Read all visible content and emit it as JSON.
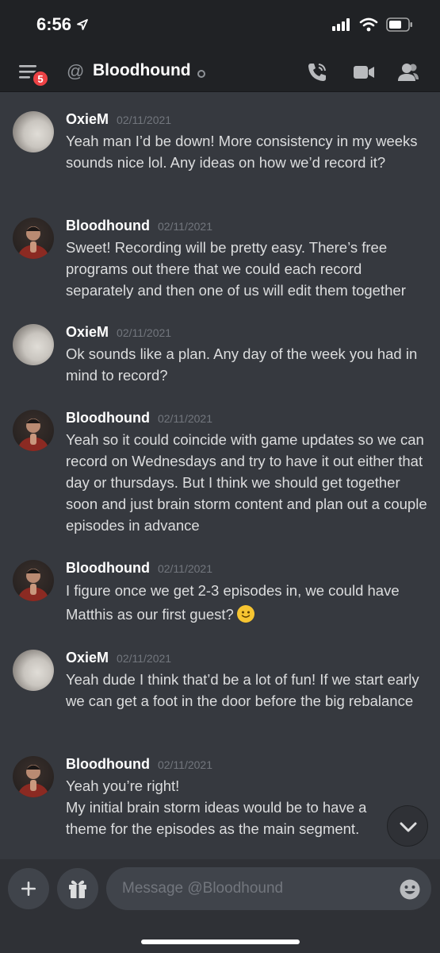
{
  "status_bar": {
    "time": "6:56"
  },
  "header": {
    "title": "Bloodhound",
    "badge": "5"
  },
  "messages": [
    {
      "author": "OxieM",
      "timestamp": "02/11/2021",
      "text": "Yeah man I’d be down! More consistency in my weeks sounds nice lol. Any ideas on how we’d record it?"
    },
    {
      "author": "Bloodhound",
      "timestamp": "02/11/2021",
      "text": "Sweet! Recording will be pretty easy. There’s free programs out there that we could each record separately and then one of us will edit them together"
    },
    {
      "author": "OxieM",
      "timestamp": "02/11/2021",
      "text": "Ok sounds like a plan. Any day of the week you had in mind to record?"
    },
    {
      "author": "Bloodhound",
      "timestamp": "02/11/2021",
      "text": "Yeah so it could coincide with game updates so we can record on Wednesdays and try to have it out either that day or thursdays. But I think we should get together soon and just brain storm content and plan out a couple episodes in advance"
    },
    {
      "author": "Bloodhound",
      "timestamp": "02/11/2021",
      "text": "I figure once we get 2-3 episodes in, we could have Matthis as our first guest?"
    },
    {
      "author": "OxieM",
      "timestamp": "02/11/2021",
      "text": "Yeah dude I think that’d be a lot of fun! If we start early we can get a foot in the door before the big rebalance"
    },
    {
      "author": "Bloodhound",
      "timestamp": "02/11/2021",
      "text_line1": "Yeah you’re right!",
      "text_line2": "My initial brain storm ideas would be to have a theme for the episodes as the main segment."
    }
  ],
  "composer": {
    "placeholder": "Message @Bloodhound"
  },
  "icons": {
    "menu": "hamburger-icon",
    "location": "location-arrow-icon",
    "call": "phone-icon",
    "video": "video-camera-icon",
    "members": "members-icon",
    "add": "plus-icon",
    "gift": "gift-icon",
    "emoji": "emoji-icon",
    "scroll": "chevron-down-icon",
    "smile_emoji": "slightly-smiling-face-icon"
  },
  "colors": {
    "background": "#36393f",
    "header": "#202225",
    "badge": "#ed4245",
    "timestamp": "#72767d"
  }
}
